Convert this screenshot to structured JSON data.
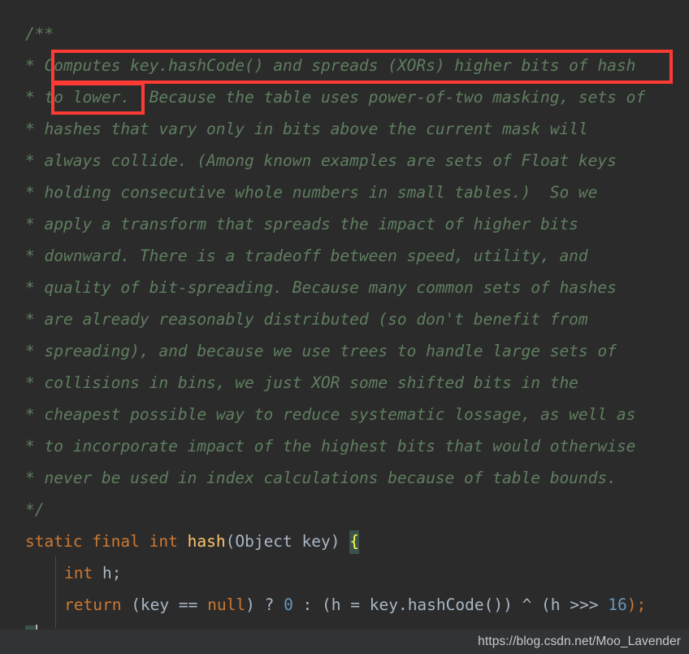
{
  "editor": {
    "language": "java",
    "background_color": "#2b2b2b",
    "theme": "darcula",
    "colors": {
      "comment": "#5f7e5f",
      "keyword": "#cc7832",
      "method": "#ffc66d",
      "identifier": "#a9b7c6",
      "number": "#6897bb",
      "brace_highlight_bg": "#3b514d",
      "brace_highlight_fg": "#ffff45",
      "annotation_red": "#fd3a34",
      "statusbar": "#313335"
    }
  },
  "comment_block": {
    "open": "/**",
    "lines": [
      "* Computes key.hashCode() and spreads (XORs) higher bits of hash",
      "* to lower.  Because the table uses power-of-two masking, sets of",
      "* hashes that vary only in bits above the current mask will",
      "* always collide. (Among known examples are sets of Float keys",
      "* holding consecutive whole numbers in small tables.)  So we",
      "* apply a transform that spreads the impact of higher bits",
      "* downward. There is a tradeoff between speed, utility, and",
      "* quality of bit-spreading. Because many common sets of hashes",
      "* are already reasonably distributed (so don't benefit from",
      "* spreading), and because we use trees to handle large sets of",
      "* collisions in bins, we just XOR some shifted bits in the",
      "* cheapest possible way to reduce systematic lossage, as well as",
      "* to incorporate impact of the highest bits that would otherwise",
      "* never be used in index calculations because of table bounds."
    ],
    "close": "*/"
  },
  "code": {
    "signature": {
      "kw_static": "static",
      "kw_final": "final",
      "kw_int": "int",
      "method_name": "hash",
      "params": "(Object key)",
      "open_brace": "{"
    },
    "declaration": {
      "kw_int": "int",
      "rest": " h;"
    },
    "return_statement": {
      "kw_return": "return",
      "cond_open": " (key == ",
      "kw_null": "null",
      "cond_close": ") ? ",
      "zero": "0",
      "middle": " : (h = key.hashCode()) ^ (h >>> ",
      "sixteen": "16",
      "tail": ");"
    },
    "close_brace": "}"
  },
  "annotations": {
    "highlight_boxes": [
      {
        "label": "computes-spreads-highlight"
      },
      {
        "label": "to-lower-highlight"
      }
    ]
  },
  "statusbar": {
    "watermark": "https://blog.csdn.net/Moo_Lavender"
  }
}
